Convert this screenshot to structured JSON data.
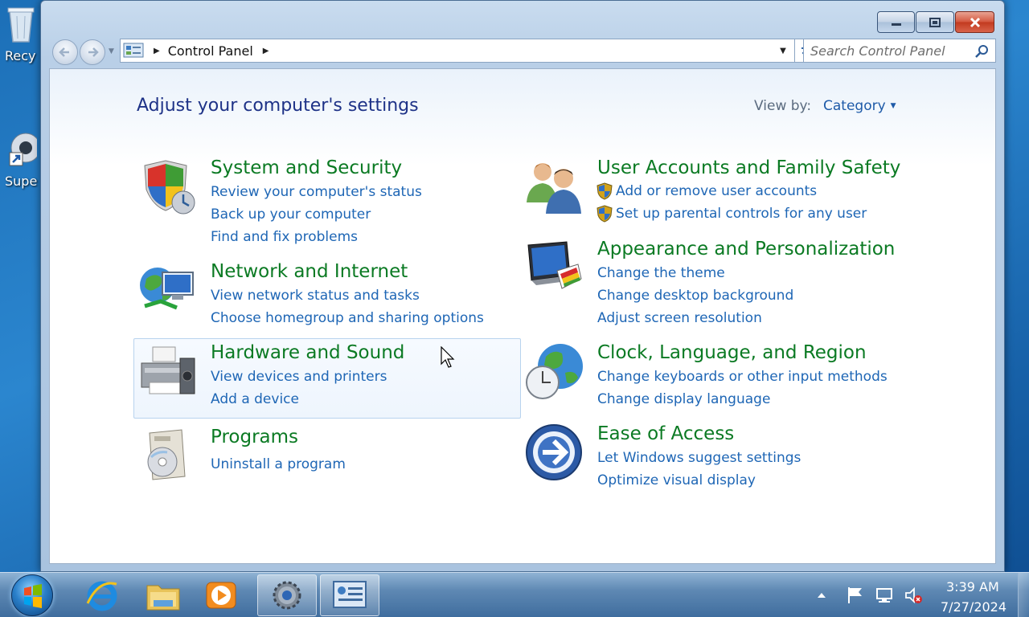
{
  "desktop": {
    "icons": [
      {
        "label": "Recy",
        "icon": "recycle-bin-icon"
      },
      {
        "label": "Supe",
        "icon": "shortcut-icon"
      }
    ]
  },
  "window": {
    "caption": {
      "minimize": "–",
      "maximize": "□",
      "close": "✕"
    },
    "address": {
      "crumb": "Control Panel"
    },
    "search": {
      "placeholder": "Search Control Panel"
    },
    "page_title": "Adjust your computer's settings",
    "view_by": {
      "label": "View by:",
      "value": "Category"
    },
    "categories": [
      {
        "title": "System and Security",
        "icon": "shield-computer-icon",
        "links": [
          "Review your computer's status",
          "Back up your computer",
          "Find and fix problems"
        ]
      },
      {
        "title": "Network and Internet",
        "icon": "network-globe-icon",
        "links": [
          "View network status and tasks",
          "Choose homegroup and sharing options"
        ]
      },
      {
        "title": "Hardware and Sound",
        "icon": "printer-icon",
        "links": [
          "View devices and printers",
          "Add a device"
        ]
      },
      {
        "title": "Programs",
        "icon": "programs-disc-icon",
        "links": [
          "Uninstall a program"
        ]
      },
      {
        "title": "User Accounts and Family Safety",
        "icon": "users-icon",
        "links": [
          "Add or remove user accounts",
          "Set up parental controls for any user"
        ]
      },
      {
        "title": "Appearance and Personalization",
        "icon": "monitor-palette-icon",
        "links": [
          "Change the theme",
          "Change desktop background",
          "Adjust screen resolution"
        ]
      },
      {
        "title": "Clock, Language, and Region",
        "icon": "clock-globe-icon",
        "links": [
          "Change keyboards or other input methods",
          "Change display language"
        ]
      },
      {
        "title": "Ease of Access",
        "icon": "ease-of-access-icon",
        "links": [
          "Let Windows suggest settings",
          "Optimize visual display"
        ]
      }
    ]
  },
  "taskbar": {
    "apps": [
      "internet-explorer-icon",
      "file-explorer-icon",
      "media-player-icon",
      "settings-gear-icon",
      "control-panel-icon"
    ],
    "clock": {
      "time": "3:39 AM",
      "date": "7/27/2024"
    }
  },
  "colors": {
    "category_title": "#0b7a23",
    "link": "#1e66b5",
    "page_title": "#1e3287"
  }
}
